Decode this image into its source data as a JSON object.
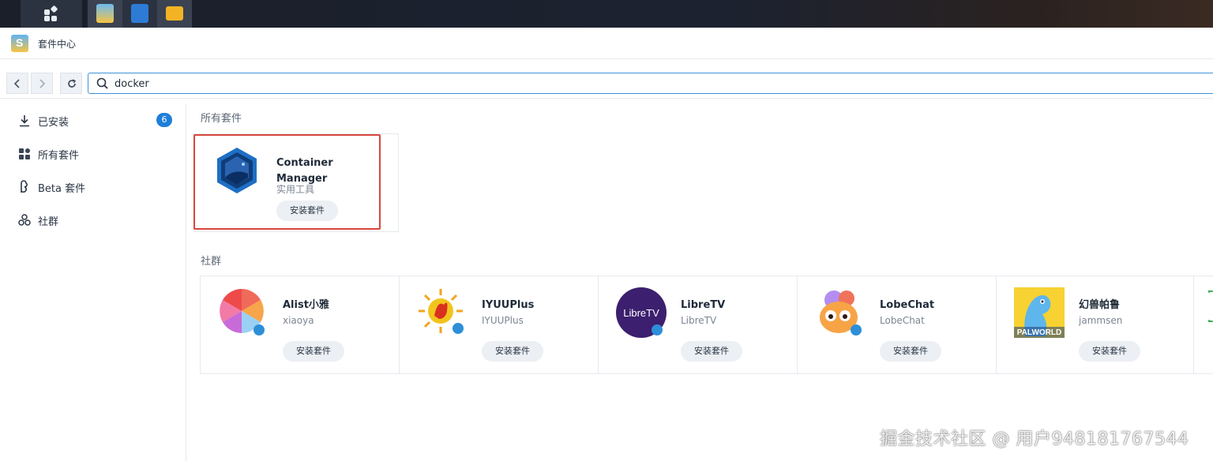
{
  "taskbar": {
    "apps": [
      {
        "name": "package-center-app",
        "color": "#f6b84a"
      },
      {
        "name": "dsm-dashboard-app",
        "color": "#2e7bd6"
      },
      {
        "name": "file-station-app",
        "color": "#f4b324"
      }
    ]
  },
  "window": {
    "title": "套件中心",
    "icon": "package-center-icon"
  },
  "toolbar": {
    "search_value": "docker",
    "search_icon": "search-icon"
  },
  "sidebar": {
    "items": [
      {
        "label": "已安装",
        "icon": "download-icon",
        "badge": "6"
      },
      {
        "label": "所有套件",
        "icon": "grid-icon"
      },
      {
        "label": "Beta 套件",
        "icon": "beta-icon"
      },
      {
        "label": "社群",
        "icon": "community-icon"
      }
    ]
  },
  "main": {
    "all_packages": {
      "title": "所有套件",
      "cards": [
        {
          "name": "Container Manager",
          "sub": "实用工具",
          "button": "安装套件",
          "logo": "container-manager-logo"
        }
      ]
    },
    "community": {
      "title": "社群",
      "cards": [
        {
          "name": "Alist小雅",
          "sub": "xiaoya",
          "button": "安装套件",
          "logo": "alist-logo"
        },
        {
          "name": "IYUUPlus",
          "sub": "IYUUPlus",
          "button": "安装套件",
          "logo": "iyuu-logo"
        },
        {
          "name": "LibreTV",
          "sub": "LibreTV",
          "button": "安装套件",
          "logo": "libretv-logo",
          "logo_text": "LibreTV"
        },
        {
          "name": "LobeChat",
          "sub": "LobeChat",
          "button": "安装套件",
          "logo": "lobechat-logo"
        },
        {
          "name": "幻兽帕鲁",
          "sub": "jammsen",
          "button": "安装套件",
          "logo": "palworld-logo",
          "logo_text": "PALWORLD"
        }
      ]
    }
  },
  "watermark": "掘金技术社区 @ 用户948181767544"
}
